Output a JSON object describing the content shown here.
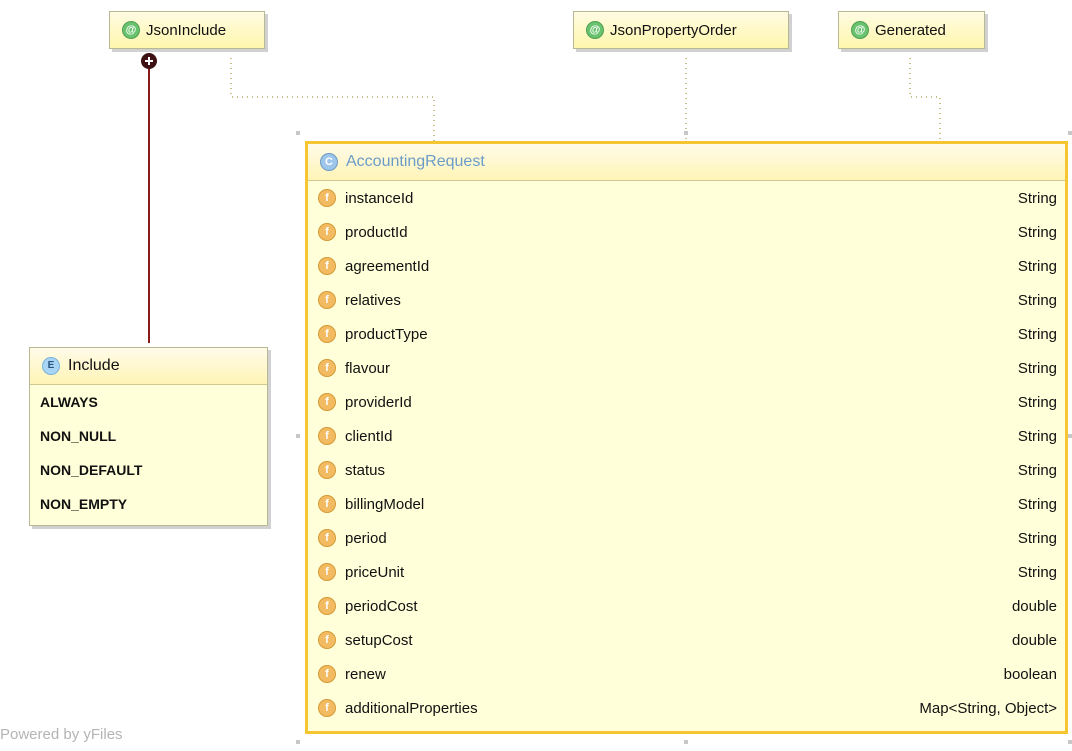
{
  "annotations": {
    "json_include": {
      "label": "JsonInclude",
      "icon": "annotation-icon",
      "symbol": "@"
    },
    "json_property_order": {
      "label": "JsonPropertyOrder",
      "icon": "annotation-icon",
      "symbol": "@"
    },
    "generated": {
      "label": "Generated",
      "icon": "annotation-icon",
      "symbol": "@"
    }
  },
  "class_node": {
    "name": "AccountingRequest",
    "icon": "class-icon",
    "symbol": "C",
    "fields": [
      {
        "name": "instanceId",
        "type": "String",
        "symbol": "f"
      },
      {
        "name": "productId",
        "type": "String",
        "symbol": "f"
      },
      {
        "name": "agreementId",
        "type": "String",
        "symbol": "f"
      },
      {
        "name": "relatives",
        "type": "String",
        "symbol": "f"
      },
      {
        "name": "productType",
        "type": "String",
        "symbol": "f"
      },
      {
        "name": "flavour",
        "type": "String",
        "symbol": "f"
      },
      {
        "name": "providerId",
        "type": "String",
        "symbol": "f"
      },
      {
        "name": "clientId",
        "type": "String",
        "symbol": "f"
      },
      {
        "name": "status",
        "type": "String",
        "symbol": "f"
      },
      {
        "name": "billingModel",
        "type": "String",
        "symbol": "f"
      },
      {
        "name": "period",
        "type": "String",
        "symbol": "f"
      },
      {
        "name": "priceUnit",
        "type": "String",
        "symbol": "f"
      },
      {
        "name": "periodCost",
        "type": "double",
        "symbol": "f"
      },
      {
        "name": "setupCost",
        "type": "double",
        "symbol": "f"
      },
      {
        "name": "renew",
        "type": "boolean",
        "symbol": "f"
      },
      {
        "name": "additionalProperties",
        "type": "Map<String, Object>",
        "symbol": "f"
      }
    ]
  },
  "enum_node": {
    "name": "Include",
    "icon": "enum-icon",
    "symbol": "E",
    "values": [
      "ALWAYS",
      "NON_NULL",
      "NON_DEFAULT",
      "NON_EMPTY"
    ]
  },
  "footer": {
    "watermark": "Powered by yFiles"
  },
  "colors": {
    "node_fill": "#ffffd9",
    "selection_border": "#f5c532",
    "annotation_icon": "#69c36e",
    "class_icon": "#9ec5ea",
    "field_icon": "#f3bb61",
    "enum_icon": "#a8d5f5",
    "association_line": "#8b1a1a",
    "dotted_connector": "#c8c08b"
  }
}
